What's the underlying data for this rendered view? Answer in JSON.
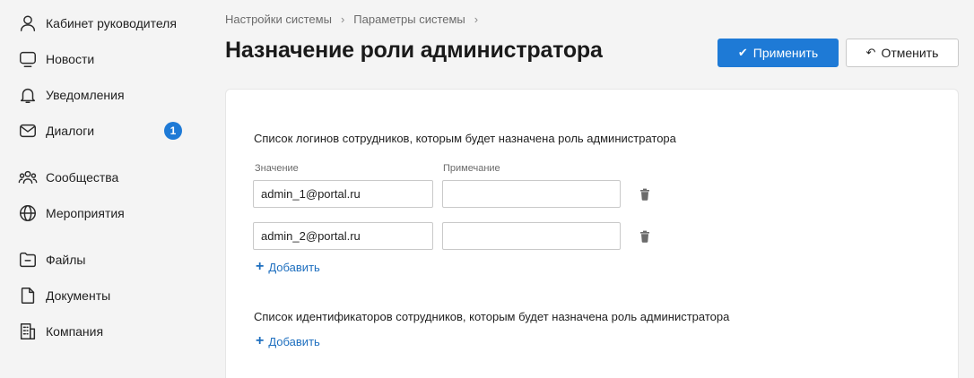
{
  "sidebar": {
    "items": [
      {
        "label": "Кабинет руководителя",
        "icon": "user-icon"
      },
      {
        "label": "Новости",
        "icon": "monitor-icon"
      },
      {
        "label": "Уведомления",
        "icon": "bell-icon"
      },
      {
        "label": "Диалоги",
        "icon": "mail-icon",
        "badge": "1"
      },
      {
        "label": "Сообщества",
        "icon": "people-icon"
      },
      {
        "label": "Мероприятия",
        "icon": "globe-icon"
      },
      {
        "label": "Файлы",
        "icon": "folder-icon"
      },
      {
        "label": "Документы",
        "icon": "document-icon"
      },
      {
        "label": "Компания",
        "icon": "building-icon"
      }
    ]
  },
  "header": {
    "breadcrumb": [
      "Настройки системы",
      "Параметры системы"
    ],
    "title": "Назначение роли администратора",
    "apply_label": "Применить",
    "cancel_label": "Отменить"
  },
  "form": {
    "logins_section_label": "Список логинов сотрудников, которым будет назначена роль администратора",
    "col_value": "Значение",
    "col_note": "Примечание",
    "rows": [
      {
        "value": "admin_1@portal.ru",
        "note": ""
      },
      {
        "value": "admin_2@portal.ru",
        "note": ""
      }
    ],
    "add_label": "Добавить",
    "ids_section_label": "Список идентификаторов сотрудников, которым будет назначена роль администратора",
    "add_label_2": "Добавить"
  },
  "colors": {
    "accent": "#1e7ad6",
    "link": "#1e6fbf",
    "background": "#f4f4f4"
  }
}
